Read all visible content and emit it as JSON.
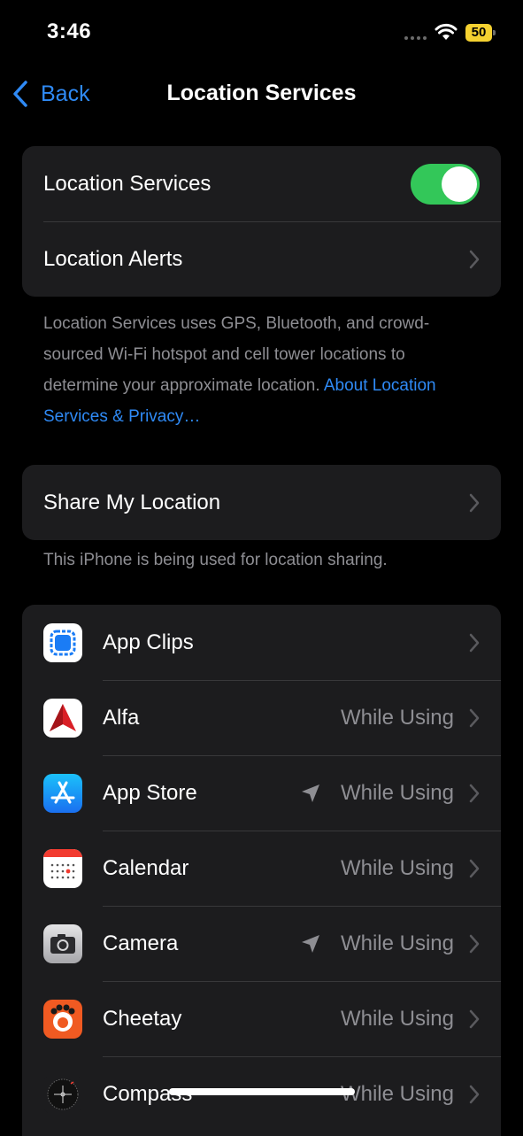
{
  "status_bar": {
    "time": "3:46",
    "battery_level": "50"
  },
  "nav": {
    "back_label": "Back",
    "title": "Location Services"
  },
  "location_group": {
    "location_services_label": "Location Services",
    "location_services_enabled": true,
    "location_alerts_label": "Location Alerts"
  },
  "footer": {
    "text": "Location Services uses GPS, Bluetooth, and crowd-sourced Wi-Fi hotspot and cell tower locations to determine your approximate location. ",
    "link": "About Location Services & Privacy…"
  },
  "share_group": {
    "label": "Share My Location"
  },
  "share_footer": "This iPhone is being used for location sharing.",
  "apps": [
    {
      "name": "App Clips",
      "icon": "app-clips-icon",
      "value": "",
      "arrow": false
    },
    {
      "name": "Alfa",
      "icon": "alfa-icon",
      "value": "While Using",
      "arrow": false
    },
    {
      "name": "App Store",
      "icon": "app-store-icon",
      "value": "While Using",
      "arrow": true
    },
    {
      "name": "Calendar",
      "icon": "calendar-icon",
      "value": "While Using",
      "arrow": false
    },
    {
      "name": "Camera",
      "icon": "camera-icon",
      "value": "While Using",
      "arrow": true
    },
    {
      "name": "Cheetay",
      "icon": "cheetay-icon",
      "value": "While Using",
      "arrow": false
    },
    {
      "name": "Compass",
      "icon": "compass-icon",
      "value": "While Using",
      "arrow": false
    }
  ],
  "colors": {
    "accent": "#2f8af5",
    "toggle_on": "#33c759",
    "battery": "#f5d130",
    "group_bg": "#1c1c1e",
    "secondary_text": "#8e8e93"
  }
}
